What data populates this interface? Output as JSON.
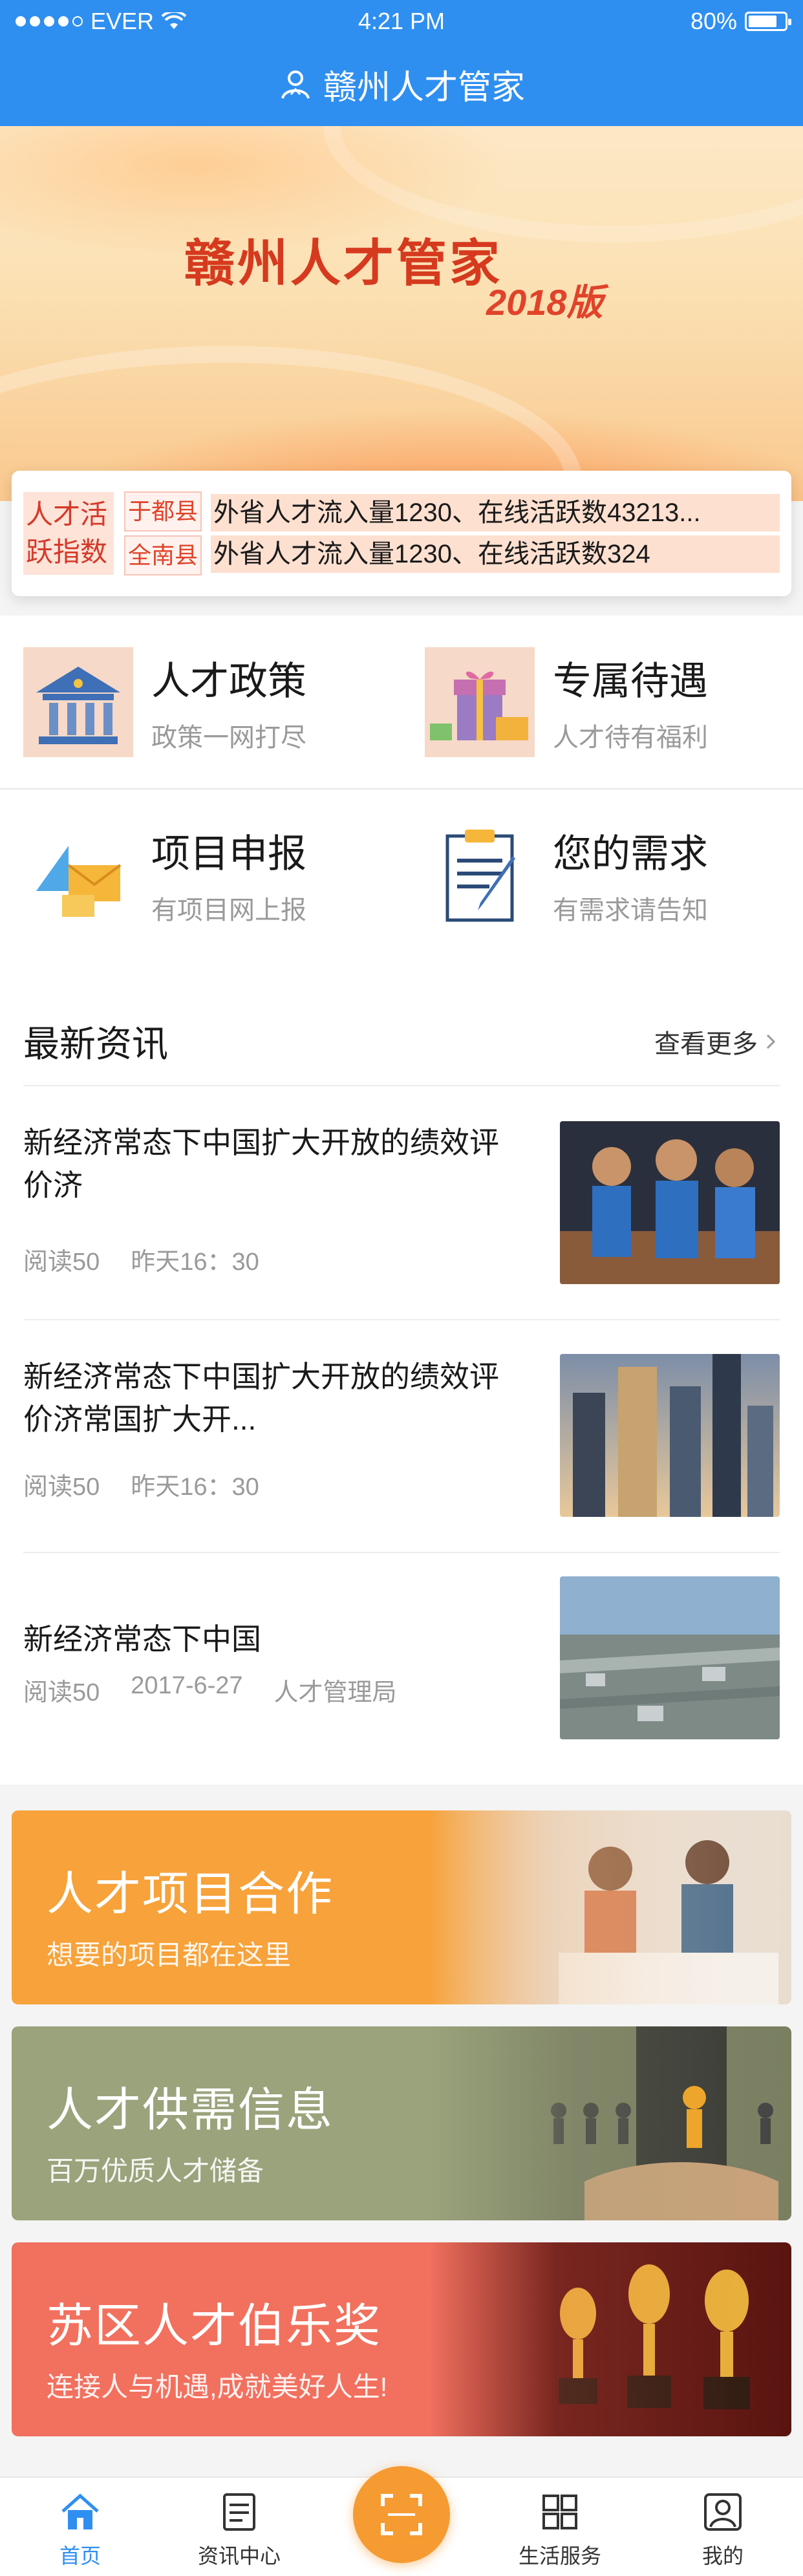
{
  "status_bar": {
    "carrier": "EVER",
    "time": "4:21 PM",
    "battery": "80%",
    "battery_level": 0.8
  },
  "nav": {
    "title": "赣州人才管家"
  },
  "hero": {
    "title": "赣州人才管家",
    "subtitle": "2018版",
    "page_count": 3,
    "active_page": 1
  },
  "ticker": {
    "label": "人才活跃指数",
    "regions": [
      "于都县",
      "全南县"
    ],
    "lines": [
      "外省人才流入量1230、在线活跃数43213...",
      "外省人才流入量1230、在线活跃数324"
    ]
  },
  "grid": [
    {
      "title": "人才政策",
      "subtitle": "政策一网打尽",
      "icon": "bank-icon"
    },
    {
      "title": "专属待遇",
      "subtitle": "人才待有福利",
      "icon": "gift-icon"
    },
    {
      "title": "项目申报",
      "subtitle": "有项目网上报",
      "icon": "envelope-arrow-icon"
    },
    {
      "title": "您的需求",
      "subtitle": "有需求请告知",
      "icon": "clipboard-pen-icon"
    }
  ],
  "news": {
    "title": "最新资讯",
    "more": "查看更多",
    "items": [
      {
        "title": "新经济常态下中国扩大开放的绩效评价济",
        "reads": "阅读50",
        "time": "昨天16：30",
        "source": ""
      },
      {
        "title": "新经济常态下中国扩大开放的绩效评价济常国扩大开...",
        "reads": "阅读50",
        "time": "昨天16：30",
        "source": ""
      },
      {
        "title": "新经济常态下中国",
        "reads": "阅读50",
        "time": "2017-6-27",
        "source": "人才管理局"
      }
    ]
  },
  "banners": [
    {
      "title": "人才项目合作",
      "subtitle": "想要的项目都在这里",
      "color": "#f7a23a"
    },
    {
      "title": "人才供需信息",
      "subtitle": "百万优质人才储备",
      "color": "#9aa37c"
    },
    {
      "title": "苏区人才伯乐奖",
      "subtitle": "连接人与机遇,成就美好人生!",
      "color": "#f2705e"
    }
  ],
  "tabs": [
    {
      "label": "首页",
      "icon": "home-icon",
      "active": true
    },
    {
      "label": "资讯中心",
      "icon": "news-icon",
      "active": false
    },
    {
      "label": "",
      "icon": "scan-icon",
      "active": false
    },
    {
      "label": "生活服务",
      "icon": "grid-icon",
      "active": false
    },
    {
      "label": "我的",
      "icon": "user-icon",
      "active": false
    }
  ],
  "colors": {
    "brand_blue": "#2f8ff0",
    "accent_orange": "#f59b32",
    "text_muted": "#9a9a9a"
  }
}
